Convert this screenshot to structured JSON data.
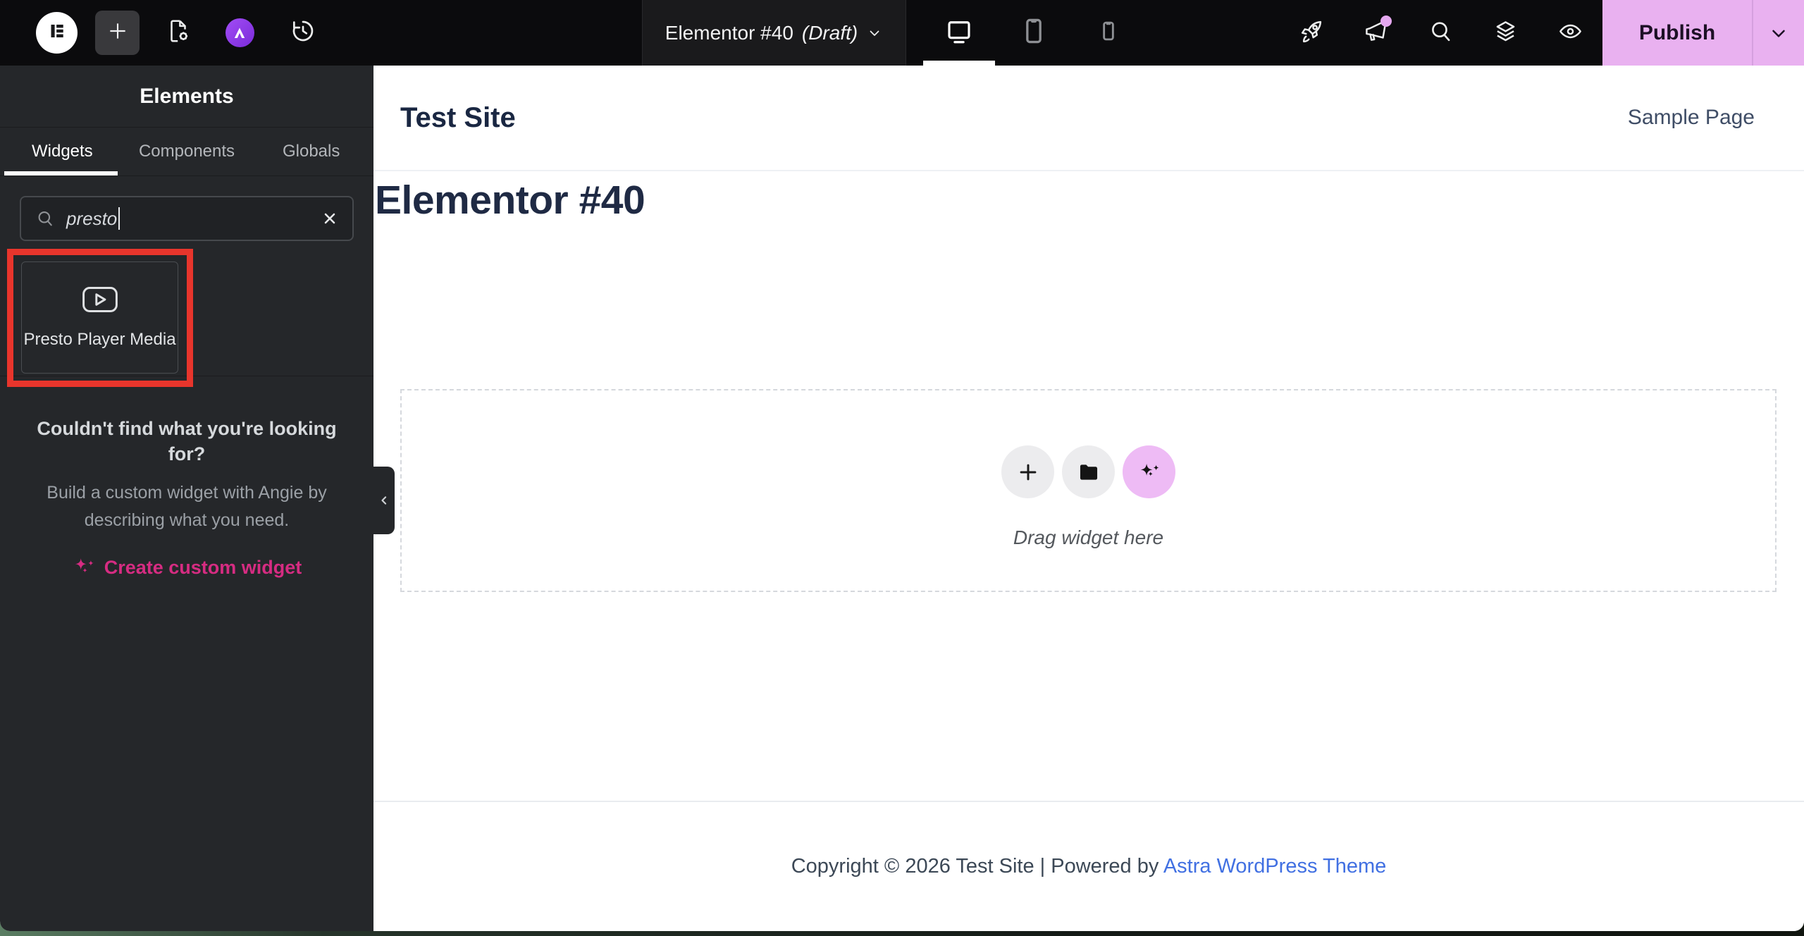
{
  "topbar": {
    "document_title": "Elementor #40",
    "document_status": "(Draft)",
    "publish_label": "Publish",
    "left_icons": [
      "elementor-logo",
      "add-element",
      "page-settings",
      "astra-ai",
      "history"
    ],
    "devices": [
      "desktop",
      "tablet",
      "mobile"
    ],
    "active_device": "desktop",
    "right_icons": [
      "launchpad-rocket",
      "whats-new-megaphone",
      "finder-search",
      "structure-layers",
      "preview-eye"
    ],
    "notification_dot_color": "#e5a8ef",
    "publish_color": "#e9b1f0"
  },
  "sidebar": {
    "panel_title": "Elements",
    "tabs": [
      {
        "label": "Widgets",
        "active": true
      },
      {
        "label": "Components",
        "active": false
      },
      {
        "label": "Globals",
        "active": false
      }
    ],
    "search": {
      "value": "presto",
      "icon": "search-icon",
      "clear_icon": "close-icon"
    },
    "results": [
      {
        "label": "Presto Player Media",
        "icon": "video-play-icon",
        "highlighted": true
      }
    ],
    "highlight_color": "#e8352c",
    "help": {
      "heading": "Couldn't find what you're looking for?",
      "body": "Build a custom widget with Angie by describing what you need.",
      "cta_label": "Create custom widget",
      "cta_icon": "sparkles-icon",
      "cta_color": "#d62c82"
    },
    "collapse_icon": "chevron-left-icon"
  },
  "canvas": {
    "site_title": "Test Site",
    "nav_link": "Sample Page",
    "page_heading": "Elementor #40",
    "dropzone": {
      "hint": "Drag widget here",
      "buttons": [
        "add-widget",
        "template-library-folder",
        "ai-sparkles"
      ]
    },
    "footer": {
      "text": "Copyright © 2026 Test Site | Powered by ",
      "link_label": "Astra WordPress Theme",
      "link_color": "#4170e2"
    }
  }
}
